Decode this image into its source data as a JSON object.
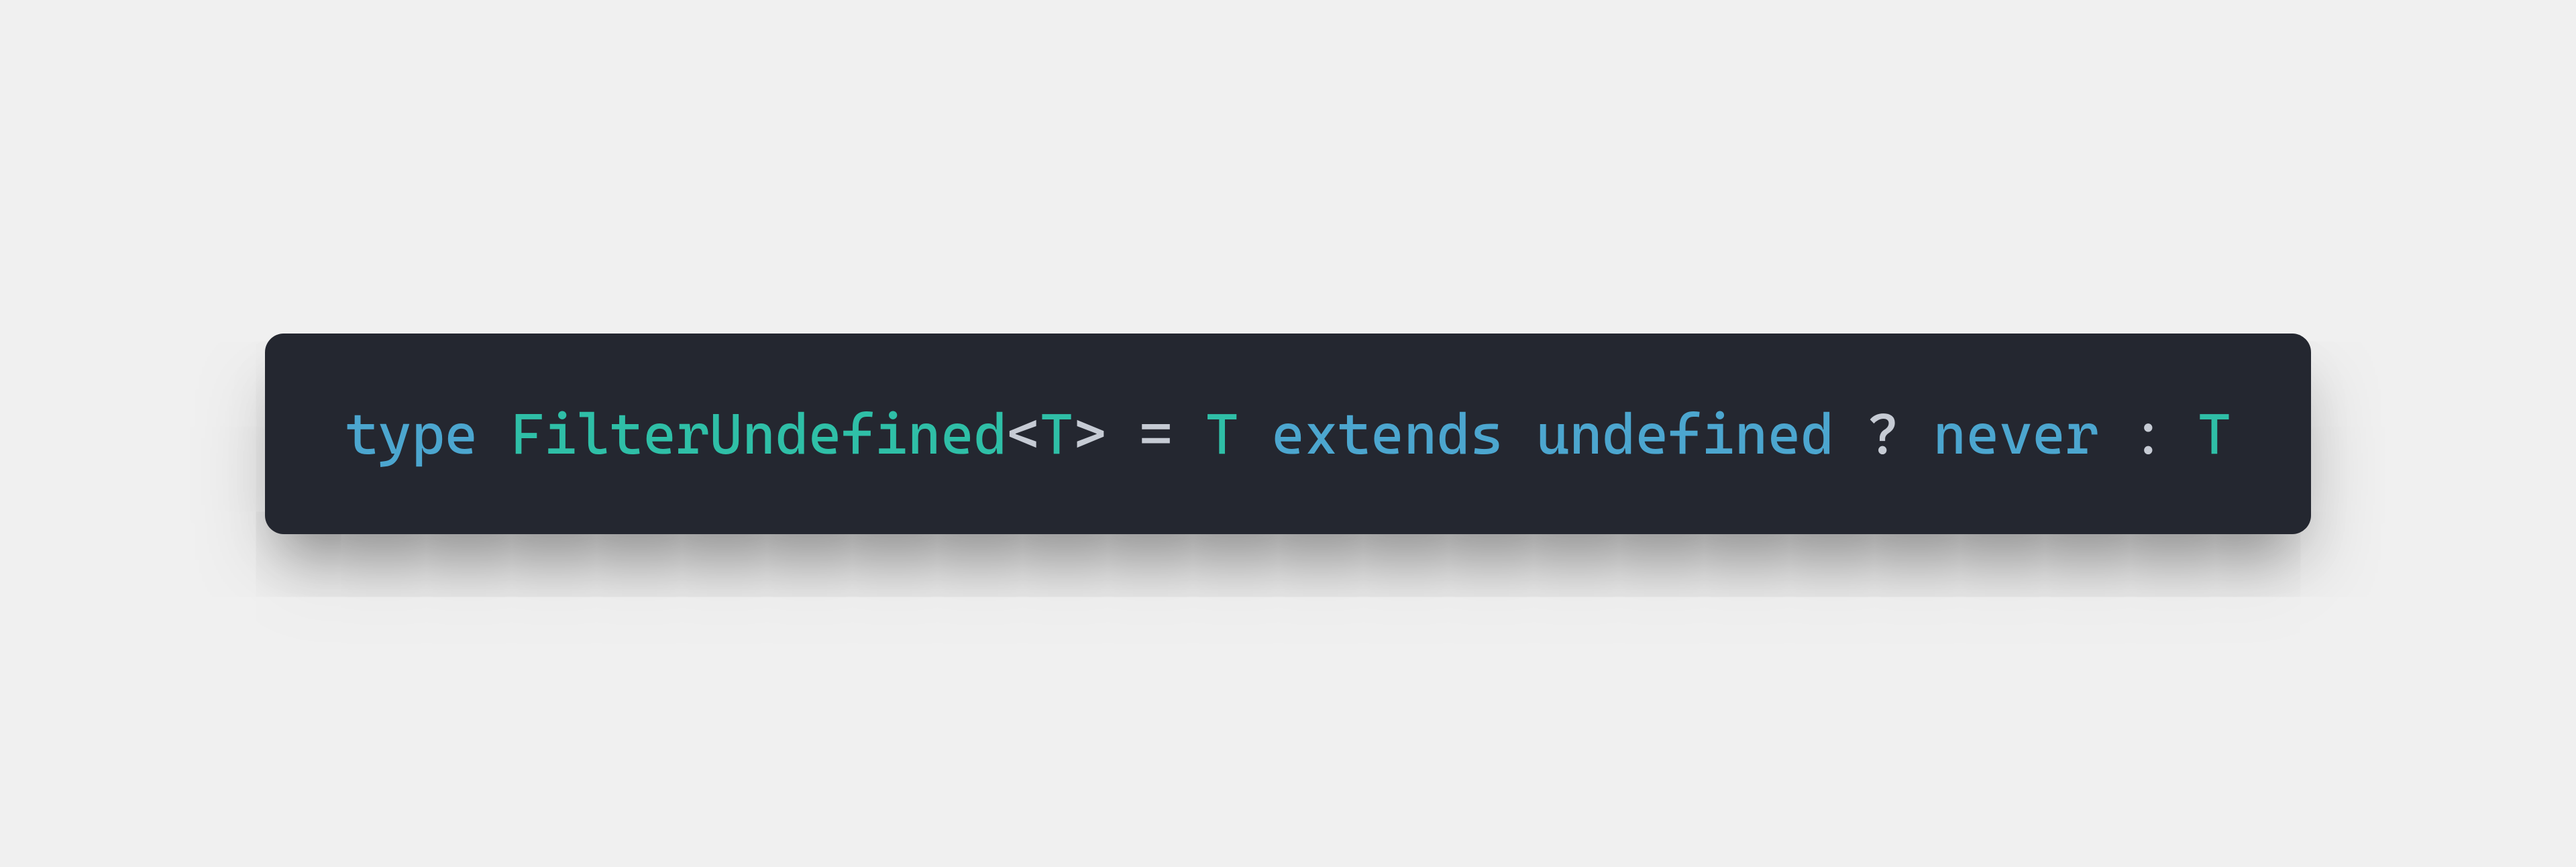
{
  "code": {
    "tokens": {
      "kw_type": "type",
      "sp1": " ",
      "type_name": "FilterUndefined",
      "lt": "<",
      "generic_T1": "T",
      "gt": ">",
      "sp2": " ",
      "eq": "=",
      "sp3": " ",
      "generic_T2": "T",
      "sp4": " ",
      "kw_extends": "extends",
      "sp5": " ",
      "kw_undefined": "undefined",
      "sp6": " ",
      "qmark": "?",
      "sp7": " ",
      "kw_never": "never",
      "sp8": " ",
      "colon": ":",
      "sp9": " ",
      "generic_T3": "T"
    }
  },
  "colors": {
    "background_page": "#f0f0f0",
    "background_code": "#242730",
    "keyword": "#4ca6cf",
    "type": "#2fbfa7",
    "punct": "#c6cbd4"
  }
}
